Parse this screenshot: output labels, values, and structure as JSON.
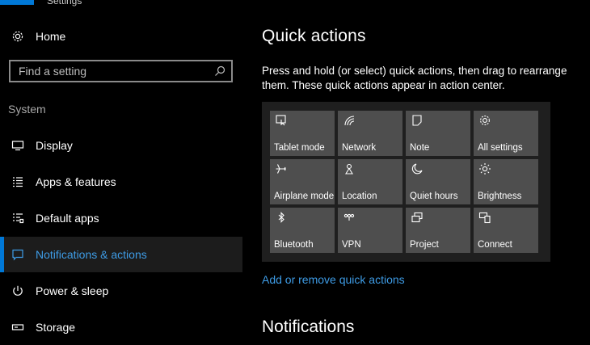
{
  "window": {
    "title_fragment": "Settings"
  },
  "sidebar": {
    "home_label": "Home",
    "search_placeholder": "Find a setting",
    "section": "System",
    "items": [
      {
        "label": "Display",
        "icon": "monitor-icon"
      },
      {
        "label": "Apps & features",
        "icon": "list-icon"
      },
      {
        "label": "Default apps",
        "icon": "default-apps-icon"
      },
      {
        "label": "Notifications & actions",
        "icon": "notification-icon",
        "active": true
      },
      {
        "label": "Power & sleep",
        "icon": "power-icon"
      },
      {
        "label": "Storage",
        "icon": "storage-icon"
      }
    ]
  },
  "main": {
    "title": "Quick actions",
    "description": "Press and hold (or select) quick actions, then drag to rearrange them. These quick actions appear in action center.",
    "tiles": [
      {
        "label": "Tablet mode",
        "icon": "tablet-mode-icon"
      },
      {
        "label": "Network",
        "icon": "network-icon"
      },
      {
        "label": "Note",
        "icon": "note-icon"
      },
      {
        "label": "All settings",
        "icon": "gear-icon"
      },
      {
        "label": "Airplane mode",
        "icon": "airplane-icon"
      },
      {
        "label": "Location",
        "icon": "location-icon"
      },
      {
        "label": "Quiet hours",
        "icon": "moon-icon"
      },
      {
        "label": "Brightness",
        "icon": "brightness-icon"
      },
      {
        "label": "Bluetooth",
        "icon": "bluetooth-icon"
      },
      {
        "label": "VPN",
        "icon": "vpn-icon"
      },
      {
        "label": "Project",
        "icon": "project-icon"
      },
      {
        "label": "Connect",
        "icon": "connect-icon"
      }
    ],
    "add_remove_link": "Add or remove quick actions",
    "notifications_title": "Notifications"
  },
  "colors": {
    "accent": "#0078d7",
    "link": "#3e9ce6",
    "tile": "#4e4e4e",
    "panel": "#1f1f1f"
  }
}
